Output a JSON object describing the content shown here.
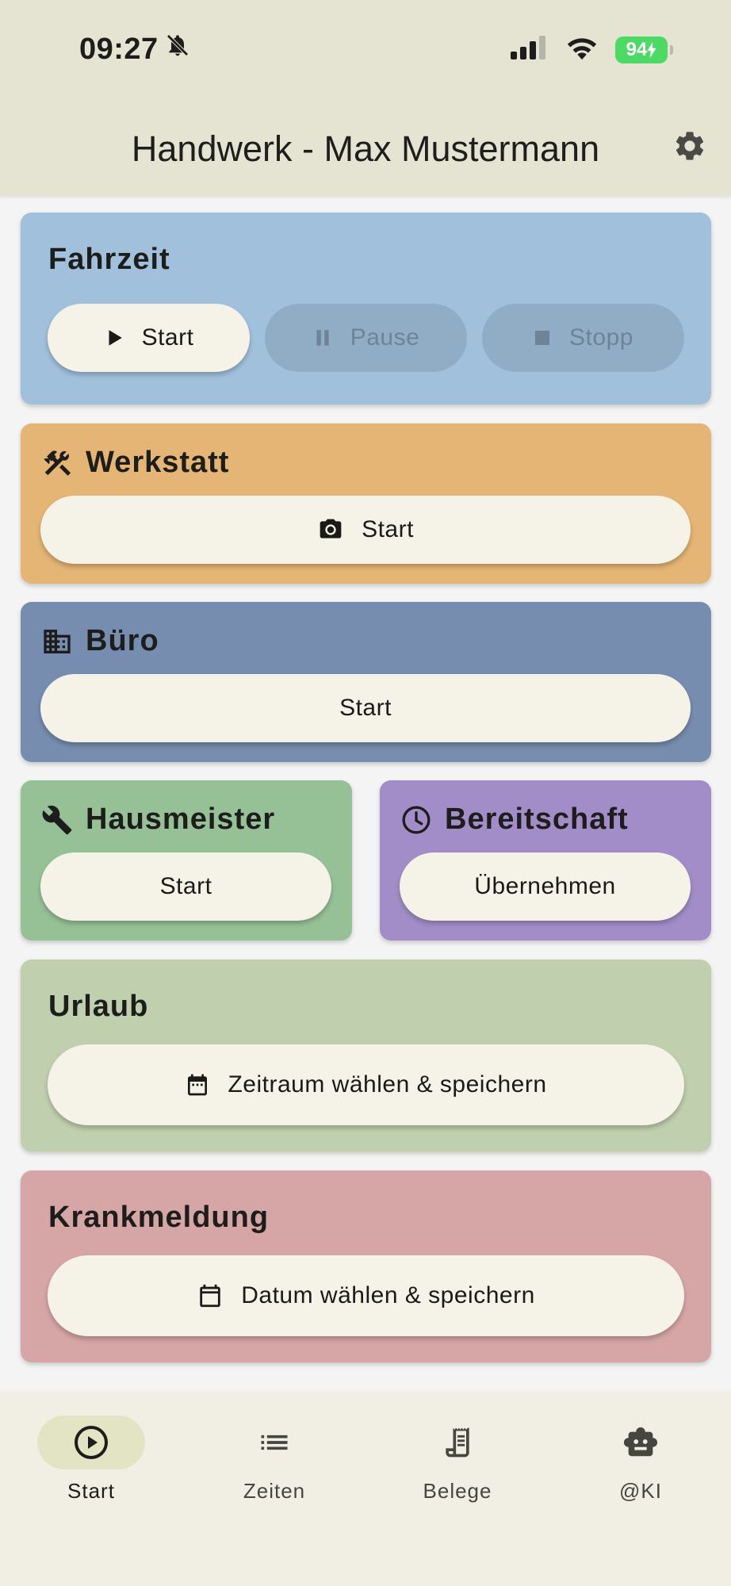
{
  "status_bar": {
    "time": "09:27",
    "battery": "94"
  },
  "app_bar": {
    "title": "Handwerk - Max Mustermann"
  },
  "cards": {
    "fahrzeit": {
      "title": "Fahrzeit",
      "start_label": "Start",
      "pause_label": "Pause",
      "stop_label": "Stopp",
      "color": "#a0c0dc"
    },
    "werkstatt": {
      "title": "Werkstatt",
      "start_label": "Start",
      "color": "#e4b574"
    },
    "buero": {
      "title": "Büro",
      "start_label": "Start",
      "color": "#778daf"
    },
    "hausmeister": {
      "title": "Hausmeister",
      "start_label": "Start",
      "color": "#96c096"
    },
    "bereitschaft": {
      "title": "Bereitschaft",
      "action_label": "Übernehmen",
      "color": "#a28dc8"
    },
    "urlaub": {
      "title": "Urlaub",
      "action_label": "Zeitraum wählen & speichern",
      "color": "#c0cfae"
    },
    "krankmeldung": {
      "title": "Krankmeldung",
      "action_label": "Datum wählen & speichern",
      "color": "#d6a6a6"
    }
  },
  "bottom_nav": {
    "items": [
      {
        "label": "Start",
        "icon": "play-circle-icon",
        "active": true
      },
      {
        "label": "Zeiten",
        "icon": "list-icon",
        "active": false
      },
      {
        "label": "Belege",
        "icon": "receipt-icon",
        "active": false
      },
      {
        "label": "@KI",
        "icon": "robot-icon",
        "active": false
      }
    ]
  }
}
